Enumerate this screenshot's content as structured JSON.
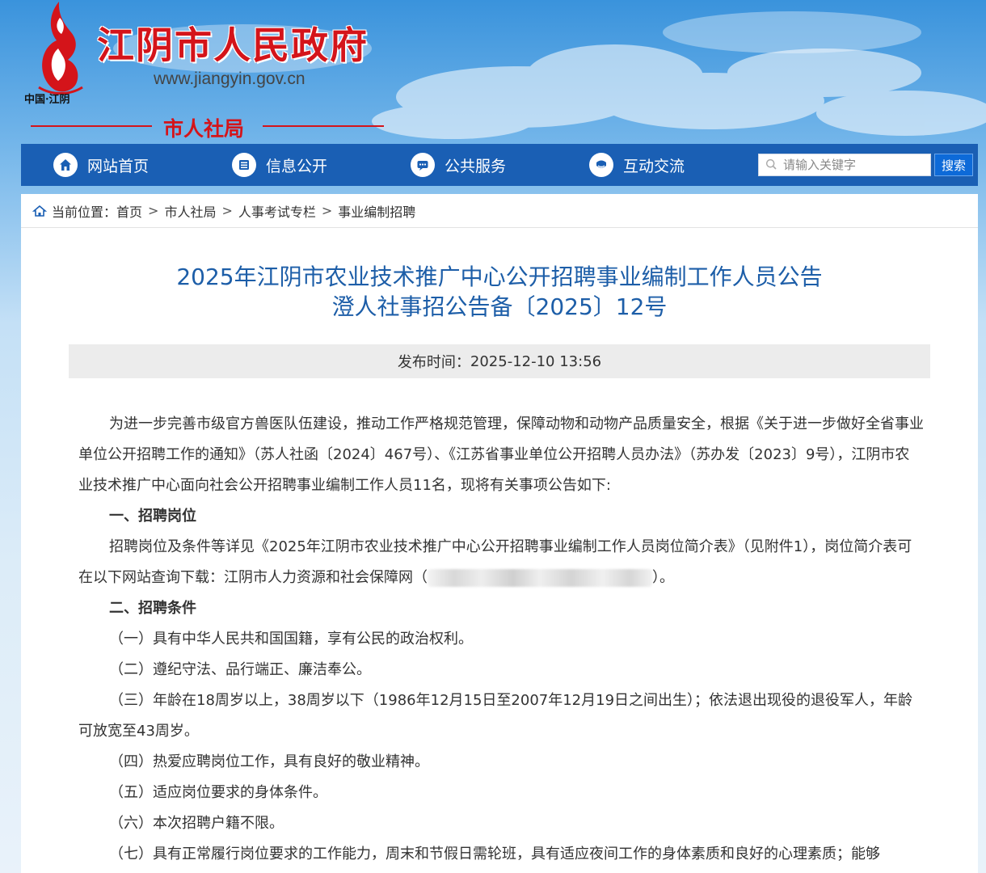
{
  "header": {
    "site_title": "江阴市人民政府",
    "site_url": "www.jiangyin.gov.cn",
    "country": "中国·江阴",
    "dept": "市人社局",
    "brand_color": "#d4141a"
  },
  "nav": {
    "items": [
      {
        "label": "网站首页",
        "icon": "home-icon"
      },
      {
        "label": "信息公开",
        "icon": "document-icon"
      },
      {
        "label": "公共服务",
        "icon": "service-icon"
      },
      {
        "label": "互动交流",
        "icon": "chat-icon"
      }
    ],
    "search_placeholder": "请输入关键字",
    "search_button": "搜索",
    "bar_color": "#1a5fb4"
  },
  "breadcrumb": {
    "prefix": "当前位置：",
    "items": [
      "首页",
      "市人社局",
      "人事考试专栏",
      "事业编制招聘"
    ],
    "separator": ">"
  },
  "article": {
    "title_line1": "2025年江阴市农业技术推广中心公开招聘事业编制工作人员公告",
    "title_line2": "澄人社事招公告备〔2025〕12号",
    "publish_label": "发布时间：",
    "publish_time": "2025-12-10 13:56",
    "intro": "为进一步完善市级官方兽医队伍建设，推动工作严格规范管理，保障动物和动物产品质量安全，根据《关于进一步做好全省事业单位公开招聘工作的通知》（苏人社函〔2024〕467号）、《江苏省事业单位公开招聘人员办法》（苏办发〔2023〕9号），江阴市农业技术推广中心面向社会公开招聘事业编制工作人员11名，现将有关事项公告如下:",
    "section1_heading": "一、招聘岗位",
    "section1_text_a": "招聘岗位及条件等详见《2025年江阴市农业技术推广中心公开招聘事业编制工作人员岗位简介表》（见附件1），岗位简介表可在以下网站查询下载：江阴市人力资源和社会保障网（",
    "section1_text_b": "）。",
    "section2_heading": "二、招聘条件",
    "conditions": [
      "（一）具有中华人民共和国国籍，享有公民的政治权利。",
      "（二）遵纪守法、品行端正、廉洁奉公。",
      "（三）年龄在18周岁以上，38周岁以下（1986年12月15日至2007年12月19日之间出生）；依法退出现役的退役军人，年龄可放宽至43周岁。",
      "（四）热爱应聘岗位工作，具有良好的敬业精神。",
      "（五）适应岗位要求的身体条件。",
      "（六）本次招聘户籍不限。",
      "（七）具有正常履行岗位要求的工作能力，周末和节假日需轮班，具有适应夜间工作的身体素质和良好的心理素质；能够"
    ],
    "title_color": "#1d5ea8"
  }
}
